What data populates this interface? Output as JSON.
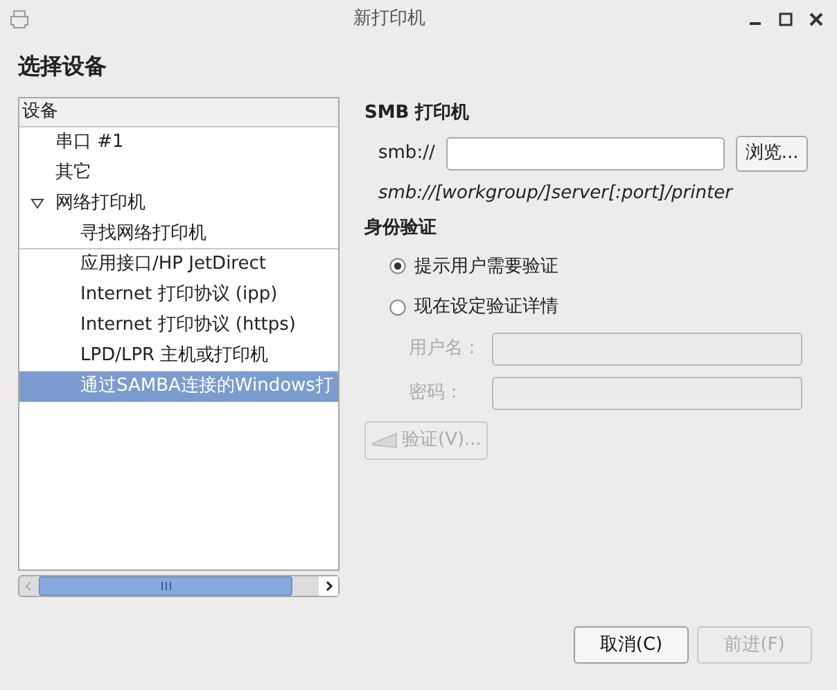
{
  "window": {
    "title": "新打印机"
  },
  "heading": "选择设备",
  "device_tree": {
    "header": "设备",
    "items": [
      {
        "label": "串口 #1",
        "selected": false
      },
      {
        "label": "其它",
        "selected": false
      },
      {
        "label": "网络打印机",
        "selected": false,
        "expanded": true,
        "children": [
          {
            "label": "寻找网络打印机",
            "selected": false,
            "separator_after": true
          },
          {
            "label": "应用接口/HP JetDirect",
            "selected": false
          },
          {
            "label": "Internet 打印协议 (ipp)",
            "selected": false
          },
          {
            "label": "Internet 打印协议 (https)",
            "selected": false
          },
          {
            "label": "LPD/LPR 主机或打印机",
            "selected": false
          },
          {
            "label": "通过SAMBA连接的Windows打",
            "selected": true
          }
        ]
      }
    ]
  },
  "smb": {
    "title": "SMB 打印机",
    "prefix": "smb://",
    "browse_button": "浏览...",
    "hint": "smb://[workgroup/]server[:port]/printer"
  },
  "auth": {
    "title": "身份验证",
    "options": [
      {
        "label": "提示用户需要验证",
        "selected": true
      },
      {
        "label": "现在设定验证详情",
        "selected": false
      }
    ],
    "fields": [
      {
        "label": "用户名：",
        "disabled": true
      },
      {
        "label": "密码：",
        "disabled": true
      }
    ],
    "verify_button": {
      "label": "验证(V)...",
      "disabled": true
    }
  },
  "buttons": [
    {
      "label": "取消(C)",
      "disabled": false
    },
    {
      "label": "前进(F)",
      "disabled": true
    }
  ]
}
